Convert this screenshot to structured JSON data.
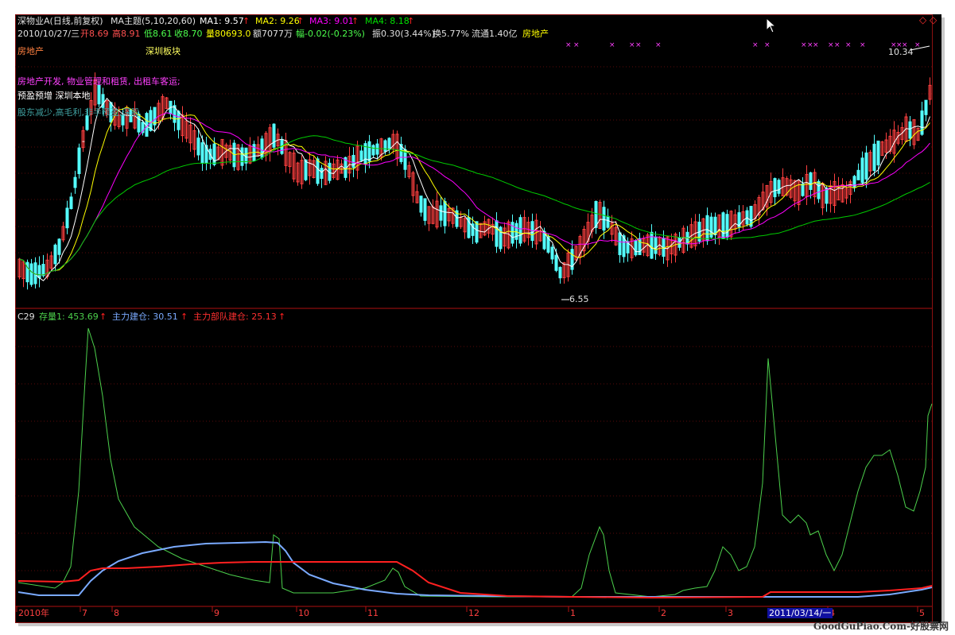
{
  "header": {
    "stock_name": "深物业A(日线,前复权)",
    "indicator": "MA主题(5,10,20,60)",
    "ma1": "MA1: 9.57",
    "ma2": "MA2: 9.26",
    "ma3": "MA3: 9.01",
    "ma4": "MA4: 8.18",
    "date": "2010/10/27/三",
    "open": "开8.69",
    "high": "高8.91",
    "low": "低8.61",
    "close": "收8.70",
    "volume": "量80693.0",
    "amount": "额7077万",
    "change": "幅-0.02(-0.23%)",
    "amplitude": "振0.30(3.44%)",
    "turnover": "换5.77%",
    "float": "流通1.40亿",
    "sector": "房地产"
  },
  "annotations": {
    "industry": "房地产",
    "board": "深圳板块",
    "business": "房地产开发, 物业管理和租赁, 出租车客运;",
    "forecast": "预盈预增 深圳本地",
    "tags": "股东减少,高毛利,非手预盈,深股",
    "max_label": "10.34",
    "min_label": "6.55",
    "dash": "-"
  },
  "indicator_panel": {
    "name": "C29",
    "line1": "存量1: 453.69",
    "line2": "主力建仓: 30.51",
    "line3": "主力部队建仓: 25.13"
  },
  "xaxis": {
    "labels": [
      "2010年",
      "7",
      "8",
      "9",
      "10",
      "11",
      "12",
      "1",
      "2",
      "3",
      "4",
      "5"
    ],
    "cursor_date": "2011/03/14/一"
  },
  "colors": {
    "bg": "#000000",
    "up": "#ff4040",
    "down": "#54ffff",
    "ma1": "#ffffff",
    "ma2": "#ffff00",
    "ma3": "#ff00ff",
    "ma4": "#00cc00",
    "grid": "#8a1010",
    "line1": "#4cd04c",
    "line2": "#7aaaff",
    "line3": "#ff2020"
  },
  "icons": [
    "diamond-icon",
    "up-arrow-icon",
    "mouse-pointer-icon",
    "x-marker-icon"
  ],
  "watermark": "GoodGuPiao.Com-好股票网"
}
